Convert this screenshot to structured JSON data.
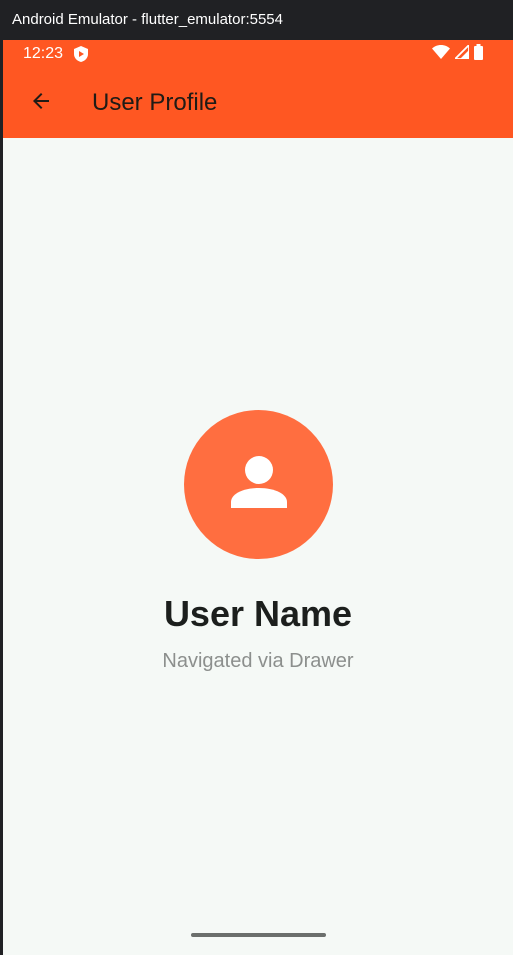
{
  "window": {
    "title": "Android Emulator - flutter_emulator:5554"
  },
  "status_bar": {
    "time": "12:23",
    "icons": [
      "shield-icon",
      "wifi-icon",
      "signal-icon",
      "battery-icon"
    ]
  },
  "app_bar": {
    "title": "User Profile",
    "back_icon": "arrow-back-icon"
  },
  "profile": {
    "avatar_icon": "person-icon",
    "name": "User Name",
    "subtitle": "Navigated via Drawer"
  },
  "colors": {
    "primary": "#ff5722",
    "avatar_bg": "#ff6e40",
    "background": "#f5f9f6"
  }
}
